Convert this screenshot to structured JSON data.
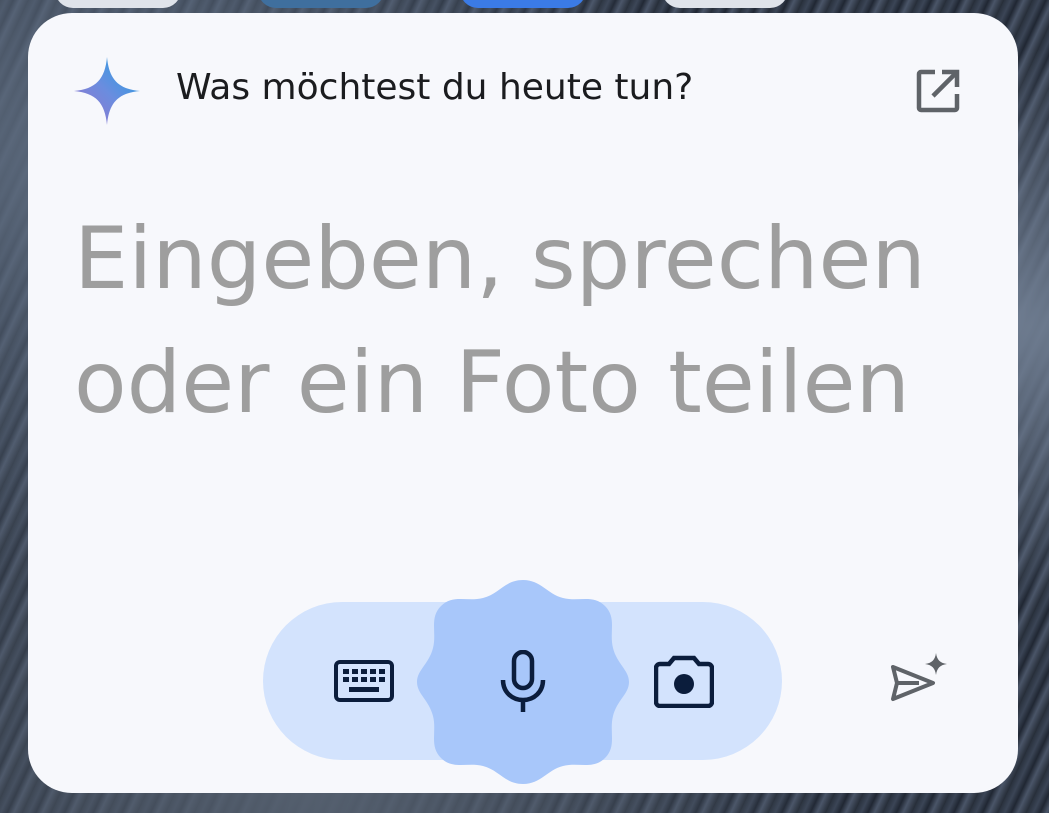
{
  "header": {
    "title": "Was möchtest du heute tun?",
    "logo_icon": "gemini-sparkle-icon",
    "open_icon": "open-in-new-icon"
  },
  "prompt": {
    "placeholder": "Eingeben, sprechen oder ein Foto teilen"
  },
  "input_bar": {
    "keyboard_icon": "keyboard-icon",
    "mic_icon": "microphone-icon",
    "camera_icon": "camera-icon",
    "send_icon": "send-sparkle-icon"
  },
  "colors": {
    "card_background": "#f7f8fc",
    "pill_background": "#d3e3fd",
    "mic_blob": "#a8c7fa",
    "icon_dark": "#0b1d3c",
    "placeholder_text": "#9e9e9e"
  }
}
